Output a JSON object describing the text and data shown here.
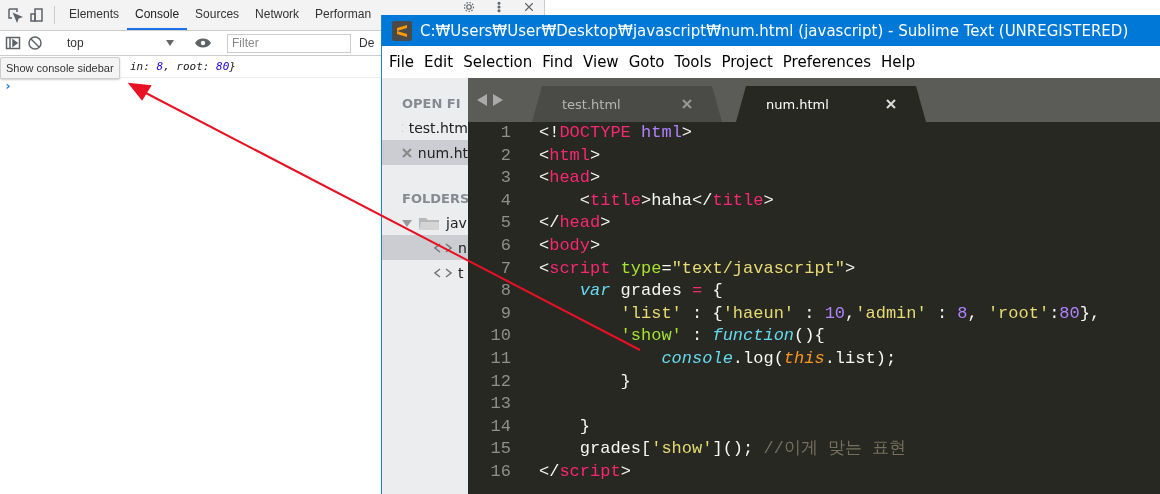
{
  "devtools": {
    "tabs": [
      {
        "label": "Elements",
        "selected": false
      },
      {
        "label": "Console",
        "selected": true
      },
      {
        "label": "Sources",
        "selected": false
      },
      {
        "label": "Network",
        "selected": false
      },
      {
        "label": "Performan",
        "selected": false
      }
    ],
    "context": "top",
    "filter": {
      "placeholder": "Filter"
    },
    "levels": "De",
    "console_message": [
      {
        "text": "in: ",
        "kind": "key"
      },
      {
        "text": "8",
        "kind": "number"
      },
      {
        "text": ", root: ",
        "kind": "key"
      },
      {
        "text": "80",
        "kind": "number"
      },
      {
        "text": "}",
        "kind": "key"
      }
    ],
    "prompt": "›",
    "tooltip": "Show console sidebar"
  },
  "editor": {
    "title": "C:₩Users₩User₩Desktop₩javascript₩num.html (javascript) - Sublime Text (UNREGISTERED)",
    "menu": [
      "File",
      "Edit",
      "Selection",
      "Find",
      "View",
      "Goto",
      "Tools",
      "Project",
      "Preferences",
      "Help"
    ],
    "sidebar": {
      "open_files_heading": "OPEN FI",
      "open_files": [
        {
          "name": "test.htm",
          "selected": false
        },
        {
          "name": "num.ht",
          "selected": true
        }
      ],
      "folders_heading": "FOLDERS",
      "folder": {
        "name": "jav",
        "expanded": true,
        "children": [
          {
            "name": "n",
            "selected": true
          },
          {
            "name": "t",
            "selected": false
          }
        ]
      }
    },
    "tabs": [
      {
        "label": "test.html",
        "selected": false
      },
      {
        "label": "num.html",
        "selected": true
      }
    ],
    "code_lines": [
      {
        "number": "1",
        "tokens": [
          {
            "text": "<!",
            "kind": "plain"
          },
          {
            "text": "DOCTYPE ",
            "kind": "tag"
          },
          {
            "text": "html",
            "kind": "number"
          },
          {
            "text": ">",
            "kind": "plain"
          }
        ]
      },
      {
        "number": "2",
        "tokens": [
          {
            "text": "<",
            "kind": "plain"
          },
          {
            "text": "html",
            "kind": "tag"
          },
          {
            "text": ">",
            "kind": "plain"
          }
        ]
      },
      {
        "number": "3",
        "tokens": [
          {
            "text": "<",
            "kind": "plain"
          },
          {
            "text": "head",
            "kind": "tag"
          },
          {
            "text": ">",
            "kind": "plain"
          }
        ]
      },
      {
        "number": "4",
        "tokens": [
          {
            "text": "    <",
            "kind": "plain"
          },
          {
            "text": "title",
            "kind": "tag"
          },
          {
            "text": ">haha</",
            "kind": "plain"
          },
          {
            "text": "title",
            "kind": "tag"
          },
          {
            "text": ">",
            "kind": "plain"
          }
        ]
      },
      {
        "number": "5",
        "tokens": [
          {
            "text": "</",
            "kind": "plain"
          },
          {
            "text": "head",
            "kind": "tag"
          },
          {
            "text": ">",
            "kind": "plain"
          }
        ]
      },
      {
        "number": "6",
        "tokens": [
          {
            "text": "<",
            "kind": "plain"
          },
          {
            "text": "body",
            "kind": "tag"
          },
          {
            "text": ">",
            "kind": "plain"
          }
        ]
      },
      {
        "number": "7",
        "tokens": [
          {
            "text": "<",
            "kind": "plain"
          },
          {
            "text": "script ",
            "kind": "tag"
          },
          {
            "text": "type",
            "kind": "attr"
          },
          {
            "text": "=",
            "kind": "plain"
          },
          {
            "text": "\"text/javascript\"",
            "kind": "string"
          },
          {
            "text": ">",
            "kind": "plain"
          }
        ]
      },
      {
        "number": "8",
        "tokens": [
          {
            "text": "    var",
            "kind": "keyword"
          },
          {
            "text": " grades ",
            "kind": "plain"
          },
          {
            "text": "=",
            "kind": "tag"
          },
          {
            "text": " {",
            "kind": "plain"
          }
        ]
      },
      {
        "number": "9",
        "tokens": [
          {
            "text": "        'list'",
            "kind": "string"
          },
          {
            "text": " : {",
            "kind": "plain"
          },
          {
            "text": "'haeun'",
            "kind": "string"
          },
          {
            "text": " : ",
            "kind": "plain"
          },
          {
            "text": "10",
            "kind": "number"
          },
          {
            "text": ",",
            "kind": "plain"
          },
          {
            "text": "'admin'",
            "kind": "string"
          },
          {
            "text": " : ",
            "kind": "plain"
          },
          {
            "text": "8",
            "kind": "number"
          },
          {
            "text": ", ",
            "kind": "plain"
          },
          {
            "text": "'root'",
            "kind": "string"
          },
          {
            "text": ":",
            "kind": "plain"
          },
          {
            "text": "80",
            "kind": "number"
          },
          {
            "text": "},",
            "kind": "plain"
          }
        ]
      },
      {
        "number": "10",
        "tokens": [
          {
            "text": "        'show'",
            "kind": "attr"
          },
          {
            "text": " : ",
            "kind": "plain"
          },
          {
            "text": "function",
            "kind": "keyword"
          },
          {
            "text": "(){",
            "kind": "plain"
          }
        ]
      },
      {
        "number": "11",
        "tokens": [
          {
            "text": "            console",
            "kind": "keyword"
          },
          {
            "text": ".log(",
            "kind": "plain"
          },
          {
            "text": "this",
            "kind": "variable"
          },
          {
            "text": ".list);",
            "kind": "plain"
          }
        ]
      },
      {
        "number": "12",
        "tokens": [
          {
            "text": "        }",
            "kind": "plain"
          }
        ]
      },
      {
        "number": "13"
      },
      {
        "number": "14",
        "tokens": [
          {
            "text": "    }",
            "kind": "plain"
          }
        ]
      },
      {
        "number": "15",
        "tokens": [
          {
            "text": "    grades[",
            "kind": "plain"
          },
          {
            "text": "'show'",
            "kind": "string"
          },
          {
            "text": "](); ",
            "kind": "plain"
          },
          {
            "text": "//이게 맞는 표현",
            "kind": "comment"
          }
        ]
      },
      {
        "number": "16",
        "tokens": [
          {
            "text": "</",
            "kind": "plain"
          },
          {
            "text": "script",
            "kind": "tag"
          },
          {
            "text": ">",
            "kind": "plain"
          }
        ]
      }
    ]
  }
}
